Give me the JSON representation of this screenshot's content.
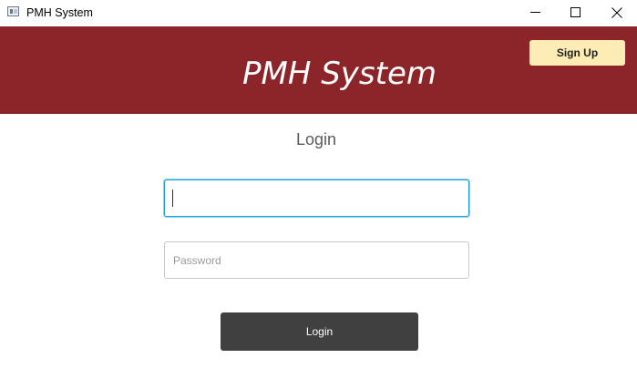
{
  "window": {
    "title": "PMH System",
    "icon": "app-window-icon"
  },
  "header": {
    "title": "PMH System",
    "signup_label": "Sign Up",
    "background_color": "#8b2529",
    "signup_color": "#fdedb4"
  },
  "form": {
    "heading": "Login",
    "username": {
      "value": "",
      "placeholder": ""
    },
    "password": {
      "value": "",
      "placeholder": "Password"
    },
    "login_label": "Login",
    "login_color": "#404040"
  }
}
